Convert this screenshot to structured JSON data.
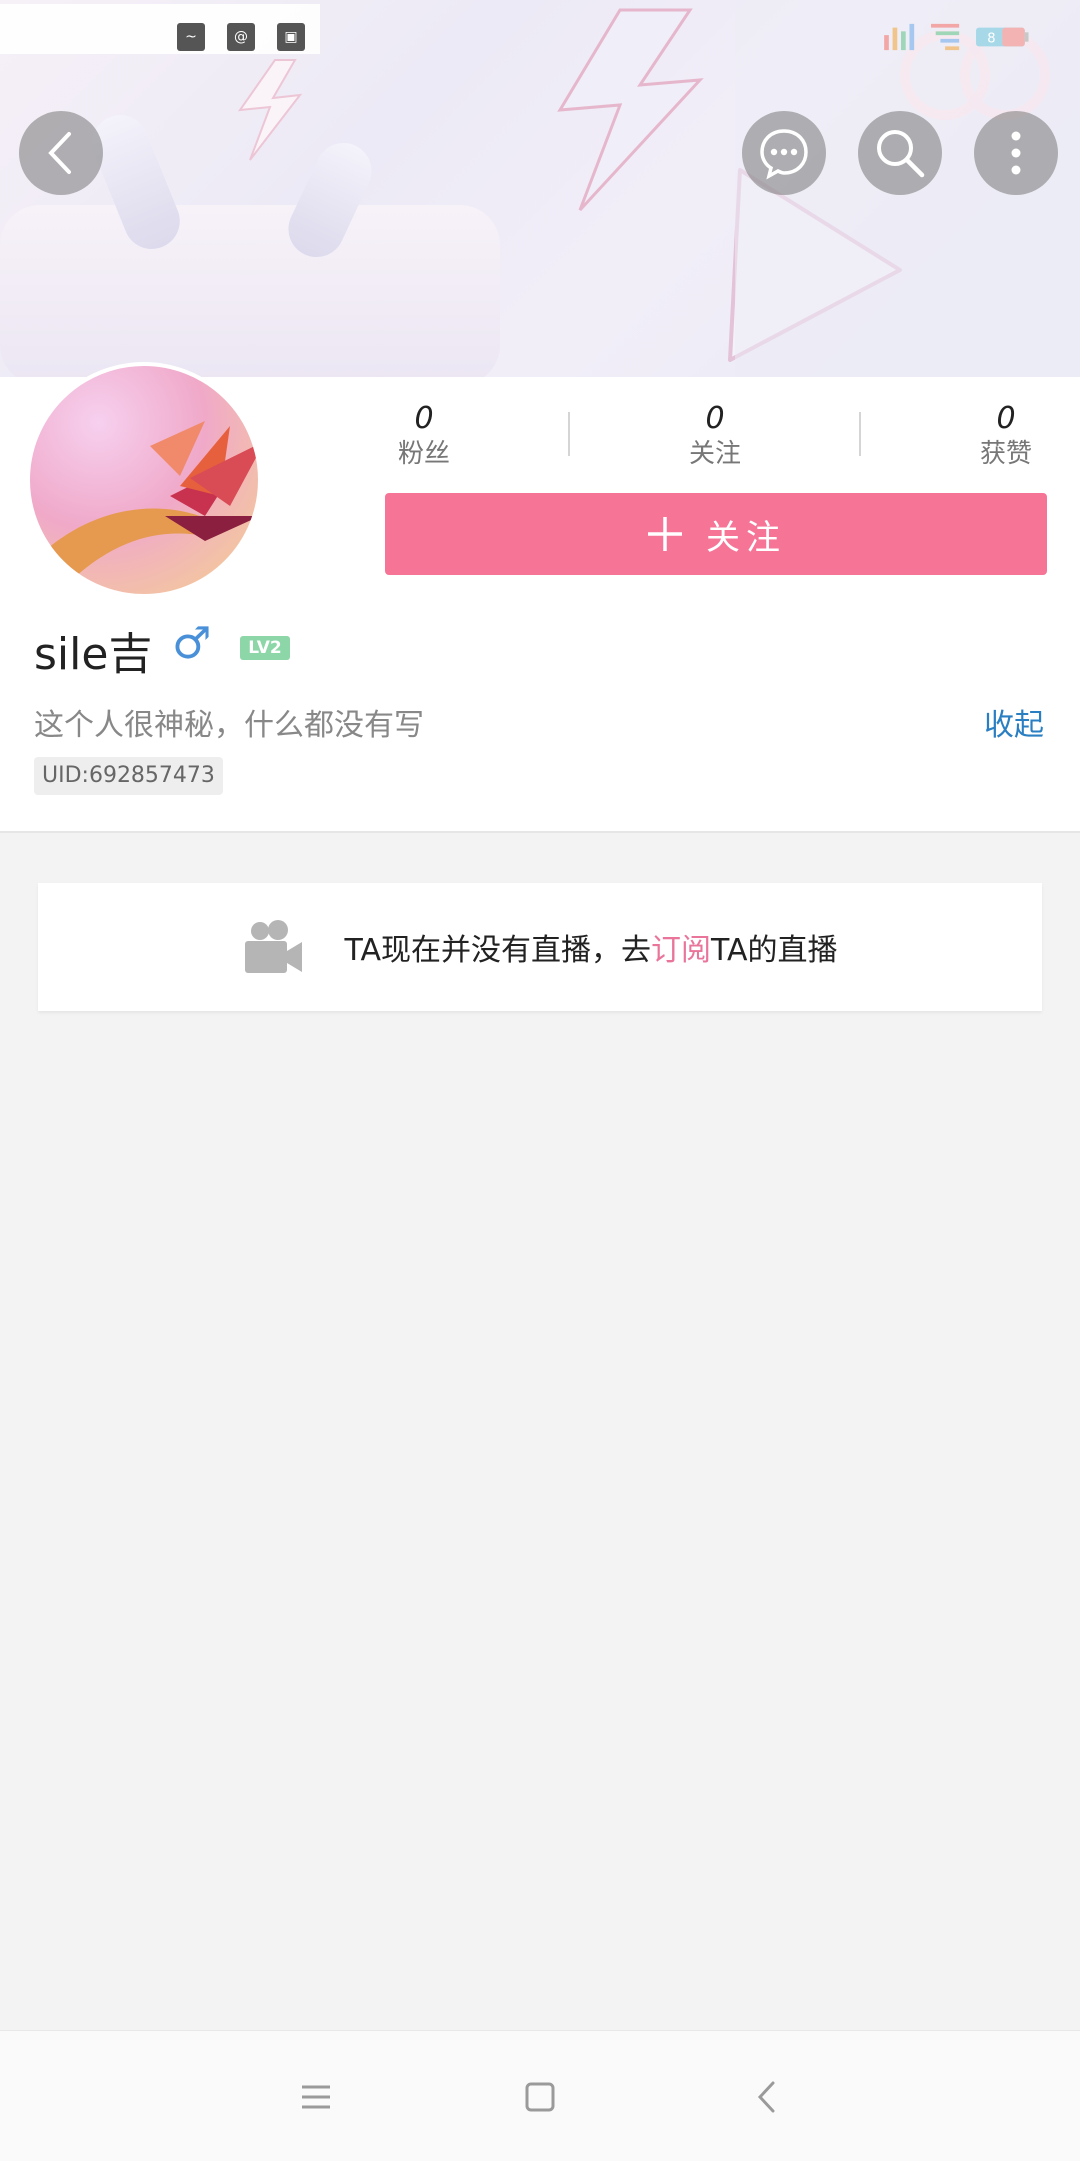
{
  "header": {
    "back_icon": "chevron-left-icon",
    "actions": [
      "message-icon",
      "search-icon",
      "more-vertical-icon"
    ]
  },
  "status_bar": {
    "left_icons": [
      "app-icon-1",
      "app-icon-2",
      "app-icon-3"
    ],
    "right_icons": [
      "signal-icon",
      "wifi-icon",
      "battery-icon"
    ],
    "battery": "8"
  },
  "profile": {
    "stats": [
      {
        "value": "0",
        "label": "粉丝"
      },
      {
        "value": "0",
        "label": "关注"
      },
      {
        "value": "0",
        "label": "获赞"
      }
    ],
    "follow_label": "关注",
    "username": "sile吉",
    "gender_symbol": "♂",
    "level": "LV2",
    "bio": "这个人很神秘，什么都没有写",
    "collapse_label": "收起",
    "uid": "UID:692857473"
  },
  "live": {
    "text_before": "TA现在并没有直播，去",
    "link": "订阅",
    "text_after": "TA的直播"
  },
  "colors": {
    "accent": "#f67597",
    "link": "#2a7fc2",
    "gender": "#4a90d9",
    "level_badge": "#8dd6a8"
  }
}
